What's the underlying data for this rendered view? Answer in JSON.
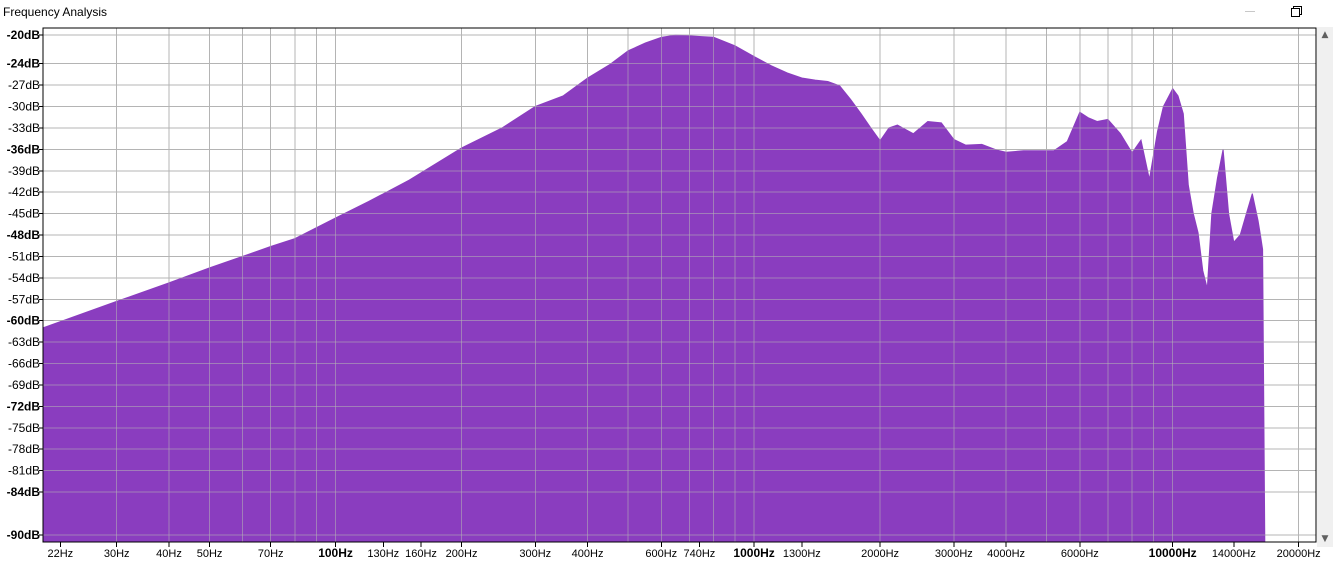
{
  "window": {
    "title": "Frequency Analysis",
    "restore_icon": "restore-window-icon",
    "minimize_icon": "minimize-window-icon"
  },
  "colors": {
    "fill": "#8a3dbf",
    "grid": "#b4b4b4",
    "axis_frame": "#000000",
    "background": "#ffffff"
  },
  "chart_data": {
    "type": "area",
    "title": "",
    "xlabel": "",
    "ylabel": "",
    "x_scale": "log",
    "xlim": [
      20,
      22000
    ],
    "ylim": [
      -91,
      -19
    ],
    "grid": true,
    "y_ticks": [
      {
        "value": -20,
        "label": "-20dB",
        "bold": true
      },
      {
        "value": -24,
        "label": "-24dB",
        "bold": true
      },
      {
        "value": -27,
        "label": "-27dB",
        "bold": false
      },
      {
        "value": -30,
        "label": "-30dB",
        "bold": false
      },
      {
        "value": -33,
        "label": "-33dB",
        "bold": false
      },
      {
        "value": -36,
        "label": "-36dB",
        "bold": true
      },
      {
        "value": -39,
        "label": "-39dB",
        "bold": false
      },
      {
        "value": -42,
        "label": "-42dB",
        "bold": false
      },
      {
        "value": -45,
        "label": "-45dB",
        "bold": false
      },
      {
        "value": -48,
        "label": "-48dB",
        "bold": true
      },
      {
        "value": -51,
        "label": "-51dB",
        "bold": false
      },
      {
        "value": -54,
        "label": "-54dB",
        "bold": false
      },
      {
        "value": -57,
        "label": "-57dB",
        "bold": false
      },
      {
        "value": -60,
        "label": "-60dB",
        "bold": true
      },
      {
        "value": -63,
        "label": "-63dB",
        "bold": false
      },
      {
        "value": -66,
        "label": "-66dB",
        "bold": false
      },
      {
        "value": -69,
        "label": "-69dB",
        "bold": false
      },
      {
        "value": -72,
        "label": "-72dB",
        "bold": true
      },
      {
        "value": -75,
        "label": "-75dB",
        "bold": false
      },
      {
        "value": -78,
        "label": "-78dB",
        "bold": false
      },
      {
        "value": -81,
        "label": "-81dB",
        "bold": false
      },
      {
        "value": -84,
        "label": "-84dB",
        "bold": true
      },
      {
        "value": -90,
        "label": "-90dB",
        "bold": true
      }
    ],
    "x_ticks": [
      {
        "value": 22,
        "label": "22Hz",
        "bold": false
      },
      {
        "value": 30,
        "label": "30Hz",
        "bold": false
      },
      {
        "value": 40,
        "label": "40Hz",
        "bold": false
      },
      {
        "value": 50,
        "label": "50Hz",
        "bold": false
      },
      {
        "value": 70,
        "label": "70Hz",
        "bold": false
      },
      {
        "value": 100,
        "label": "100Hz",
        "bold": true
      },
      {
        "value": 130,
        "label": "130Hz",
        "bold": false
      },
      {
        "value": 160,
        "label": "160Hz",
        "bold": false
      },
      {
        "value": 200,
        "label": "200Hz",
        "bold": false
      },
      {
        "value": 300,
        "label": "300Hz",
        "bold": false
      },
      {
        "value": 400,
        "label": "400Hz",
        "bold": false
      },
      {
        "value": 600,
        "label": "600Hz",
        "bold": false
      },
      {
        "value": 740,
        "label": "740Hz",
        "bold": false
      },
      {
        "value": 1000,
        "label": "1000Hz",
        "bold": true
      },
      {
        "value": 1300,
        "label": "1300Hz",
        "bold": false
      },
      {
        "value": 2000,
        "label": "2000Hz",
        "bold": false
      },
      {
        "value": 3000,
        "label": "3000Hz",
        "bold": false
      },
      {
        "value": 4000,
        "label": "4000Hz",
        "bold": false
      },
      {
        "value": 6000,
        "label": "6000Hz",
        "bold": false
      },
      {
        "value": 10000,
        "label": "10000Hz",
        "bold": true
      },
      {
        "value": 14000,
        "label": "14000Hz",
        "bold": false
      },
      {
        "value": 20000,
        "label": "20000Hz",
        "bold": false
      }
    ],
    "x_gridlines": [
      20,
      30,
      40,
      50,
      60,
      70,
      80,
      90,
      100,
      200,
      300,
      400,
      500,
      600,
      700,
      800,
      900,
      1000,
      2000,
      3000,
      4000,
      5000,
      6000,
      7000,
      8000,
      9000,
      10000,
      20000
    ],
    "series": [
      {
        "x": [
          20,
          30,
          40,
          50,
          60,
          70,
          80,
          100,
          120,
          150,
          200,
          250,
          300,
          350,
          400,
          450,
          500,
          550,
          600,
          650,
          700,
          750,
          800,
          900,
          1000,
          1100,
          1200,
          1300,
          1400,
          1500,
          1600,
          1700,
          1800,
          1900,
          2000,
          2100,
          2200,
          2400,
          2600,
          2800,
          3000,
          3200,
          3500,
          3800,
          4000,
          4400,
          4800,
          5200,
          5600,
          6000,
          6300,
          6600,
          7000,
          7500,
          8000,
          8400,
          8800,
          9200,
          9500,
          9800,
          10000,
          10300,
          10600,
          10900,
          11200,
          11500,
          11800,
          12100,
          12400,
          12800,
          13200,
          13600,
          14000,
          14500,
          15000,
          15500,
          16000,
          16200,
          16400,
          16600
        ],
        "y": [
          -61,
          -57.3,
          -54.7,
          -52.6,
          -51,
          -49.6,
          -48.5,
          -45.6,
          -43.3,
          -40.3,
          -35.8,
          -33,
          -30,
          -28.5,
          -26,
          -24.2,
          -22.2,
          -21.1,
          -20.3,
          -20,
          -20.1,
          -20.2,
          -20.3,
          -21.5,
          -23,
          -24.3,
          -25.3,
          -26,
          -26.3,
          -26.5,
          -27.1,
          -29,
          -31,
          -33,
          -34.8,
          -33,
          -32.6,
          -33.8,
          -32.1,
          -32.3,
          -34.6,
          -35.4,
          -35.3,
          -36.1,
          -36.4,
          -36.2,
          -36.2,
          -36.2,
          -34.9,
          -30.8,
          -31.6,
          -32.1,
          -31.8,
          -33.8,
          -36.5,
          -34.7,
          -40.2,
          -33.5,
          -30,
          -28.5,
          -27.5,
          -28.5,
          -31,
          -41,
          -45,
          -47.7,
          -53,
          -55.5,
          -45,
          -40,
          -36,
          -45,
          -49,
          -48,
          -45,
          -42.2,
          -46,
          -48,
          -50,
          -91
        ]
      }
    ]
  }
}
